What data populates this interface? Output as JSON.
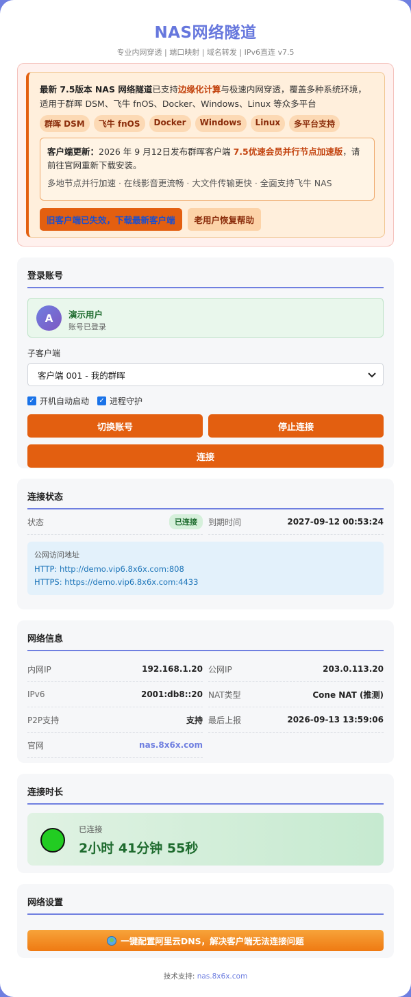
{
  "header": {
    "title": "NAS网络隧道",
    "subtitle": "专业内网穿透 | 端口映射 | 域名转发 | IPv6直连 v7.5"
  },
  "notice": {
    "line_a": "最新 7.5版本 NAS 网络隧道",
    "line_b": "已支持",
    "line_c": "边缘化计算",
    "line_d": "与极速内网穿透，覆盖多种系统环境，适用于群晖 DSM、飞牛 fnOS、Docker、Windows、Linux 等众多平台",
    "tags": [
      "群晖 DSM",
      "飞牛 fnOS",
      "Docker",
      "Windows",
      "Linux",
      "多平台支持"
    ],
    "update_label": "客户端更新：",
    "update_text": "2026 年 9 月12日发布群晖客户端 ",
    "update_highlight": "7.5优速会员并行节点加速版",
    "update_tail": "，请前往官网重新下载安装。",
    "update_line2": "多地节点并行加速 · 在线影音更流畅 · 大文件传输更快 · 全面支持飞牛 NAS",
    "btn_download": "旧客户端已失效，下载最新客户端",
    "btn_help": "老用户恢复帮助"
  },
  "login": {
    "title": "登录账号",
    "avatar_letter": "A",
    "user_name": "演示用户",
    "user_status": "账号已登录",
    "client_label": "子客户端",
    "client_selected": "客户端 001 - 我的群晖",
    "check_autostart": "开机自动启动",
    "check_daemon": "进程守护",
    "btn_switch": "切换账号",
    "btn_stop": "停止连接",
    "btn_connect": "连接"
  },
  "status": {
    "title": "连接状态",
    "state_label": "状态",
    "state_value": "已连接",
    "expire_label": "到期时间",
    "expire_value": "2027-09-12 00:53:24",
    "public_title": "公网访问地址",
    "http_url": "HTTP: http://demo.vip6.8x6x.com:808",
    "https_url": "HTTPS: https://demo.vip6.8x6x.com:4433"
  },
  "network": {
    "title": "网络信息",
    "rows": [
      {
        "k": "内网IP",
        "v": "192.168.1.20"
      },
      {
        "k": "公网IP",
        "v": "203.0.113.20"
      },
      {
        "k": "IPv6",
        "v": "2001:db8::20"
      },
      {
        "k": "NAT类型",
        "v": "Cone NAT (推测)"
      },
      {
        "k": "P2P支持",
        "v": "支持"
      },
      {
        "k": "最后上报",
        "v": "2026-09-13 13:59:06"
      },
      {
        "k": "官网",
        "v": "nas.8x6x.com"
      }
    ]
  },
  "duration": {
    "title": "连接时长",
    "label": "已连接",
    "value": "2小时 41分钟 55秒"
  },
  "settings": {
    "title": "网络设置",
    "dns_button": "一键配置阿里云DNS，解决客户端无法连接问题"
  },
  "footer": {
    "prefix": "技术支持: ",
    "link": "nas.8x6x.com"
  }
}
